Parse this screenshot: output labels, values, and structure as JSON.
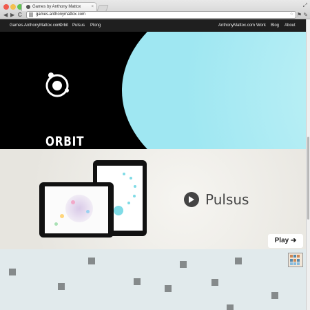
{
  "browser": {
    "tab_title": "Games by Anthony Mattox",
    "tab_close": "×",
    "url": "games.anthonymattox.com",
    "back": "◀",
    "forward": "▶",
    "reload": "C",
    "star": "☆",
    "tools": "⚑ ✎"
  },
  "site_nav": {
    "brand": "Games.AnthonyMattox.com",
    "left_links": [
      "Orbit",
      "Pulsus",
      "Plong"
    ],
    "right_links": [
      "AnthonyMattox.com",
      "Work",
      "Blog",
      "About"
    ]
  },
  "orbit": {
    "title": "ORBIT"
  },
  "pulsus": {
    "title": "Pulsus",
    "play_label": "Play ➔"
  },
  "colors": {
    "nav_bg": "#1f1f1f",
    "orbit_cyan": "#a6eaf3",
    "plong_bg": "#e1eaec",
    "square": "#858a8b"
  }
}
